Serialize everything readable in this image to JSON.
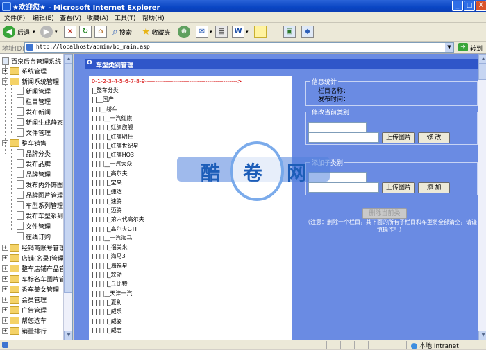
{
  "window": {
    "title": "★欢迎您★ - Microsoft Internet Explorer",
    "buttons": {
      "minimize": "_",
      "maximize": "□",
      "close": "X"
    }
  },
  "menu": [
    "文件(F)",
    "编辑(E)",
    "查看(V)",
    "收藏(A)",
    "工具(T)",
    "帮助(H)"
  ],
  "toolbar": {
    "back_label": "后退",
    "search_label": "搜索",
    "favorites_label": "收藏夹",
    "back_glyph": "◀",
    "forward_glyph": "▶",
    "stop_glyph": "×",
    "refresh_glyph": "↻",
    "home_glyph": "⌂",
    "history_glyph": "⊕",
    "edit_glyph": "✉",
    "print_glyph": "▤",
    "word_glyph": "W",
    "messenger_glyph": "▣",
    "media_glyph": "◆"
  },
  "address": {
    "label": "地址(D)",
    "url": "http://localhost/admin/bq_main.asp",
    "go_label": "转到"
  },
  "sidebar": {
    "root": "百泉后台管理系统",
    "groups": [
      {
        "label": "系统管理",
        "expanded": false,
        "items": []
      },
      {
        "label": "新闻系统管理",
        "expanded": true,
        "items": [
          "新闻管理",
          "栏目管理",
          "发布新闻",
          "新闻生成静态",
          "文件管理"
        ]
      },
      {
        "label": "整车销售",
        "expanded": true,
        "items": [
          "品牌分类",
          "发布品牌",
          "品牌管理",
          "发布内外饰图片",
          "品牌图片管理",
          "车型系列管理",
          "发布车型系列",
          "文件管理",
          "在线订购"
        ]
      },
      {
        "label": "经销商账号管理",
        "expanded": false,
        "items": []
      },
      {
        "label": "店铺(名录)管理",
        "expanded": false,
        "items": []
      },
      {
        "label": "整车店铺产品管理",
        "expanded": false,
        "items": []
      },
      {
        "label": "车标名车图片管理",
        "expanded": false,
        "items": []
      },
      {
        "label": "香车美女管理",
        "expanded": false,
        "items": []
      },
      {
        "label": "会员管理",
        "expanded": false,
        "items": []
      },
      {
        "label": "广告管理",
        "expanded": false,
        "items": []
      },
      {
        "label": "帮您选车",
        "expanded": false,
        "items": []
      },
      {
        "label": "销量排行",
        "expanded": false,
        "items": []
      }
    ]
  },
  "main": {
    "header_marker": "O",
    "header": "车型类别管理",
    "tree": {
      "ruler": "0-1-2-3-4-5-6-7-8-9---------------------------------------------->",
      "rows": [
        "|_整车分类",
        "| |__国产",
        "| | |__轿车",
        "| | | |__一汽红旗",
        "| | | | |_红旗旗舰",
        "| | | | |_红旗明仕",
        "| | | | |_红旗世纪星",
        "| | | | |_红旗HQ3",
        "| | | |__一汽大众",
        "| | | | |_高尔夫",
        "| | | | |_宝来",
        "| | | | |_捷达",
        "| | | | |_速腾",
        "| | | | |_迈腾",
        "| | | | |_第六代高尔夫",
        "| | | | |_高尔夫GTI",
        "| | | |__一汽海马",
        "| | | | |_福美来",
        "| | | | |_海马3",
        "| | | | |_海福星",
        "| | | | |_欢动",
        "| | | | |_丘比特",
        "| | | |__天津一汽",
        "| | | | |_夏利",
        "| | | | |_威乐",
        "| | | | |_威姿",
        "| | | | |_威志"
      ]
    },
    "info": {
      "legend": "信息统计",
      "name_label": "栏目名称：",
      "time_label": "发布时间："
    },
    "modify": {
      "legend": "修改当前类别",
      "upload_label": "上传图片",
      "submit_label": "修 改"
    },
    "add": {
      "legend": "添加子类别",
      "upload_label": "上传图片",
      "submit_label": "添 加"
    },
    "delete_label": "删除当前类",
    "note": "（注意：删除一个栏目，其下面的所有子栏目和车型将全部清空，请谨慎操作！）"
  },
  "watermark": [
    "酷",
    "卷",
    "网"
  ],
  "status": {
    "zone": "本地 Intranet"
  },
  "colors": {
    "title_bar": "#0a46c4",
    "main_bg": "#6a8be3",
    "header_bg": "#2f56c9",
    "ruler_red": "#d40000"
  }
}
